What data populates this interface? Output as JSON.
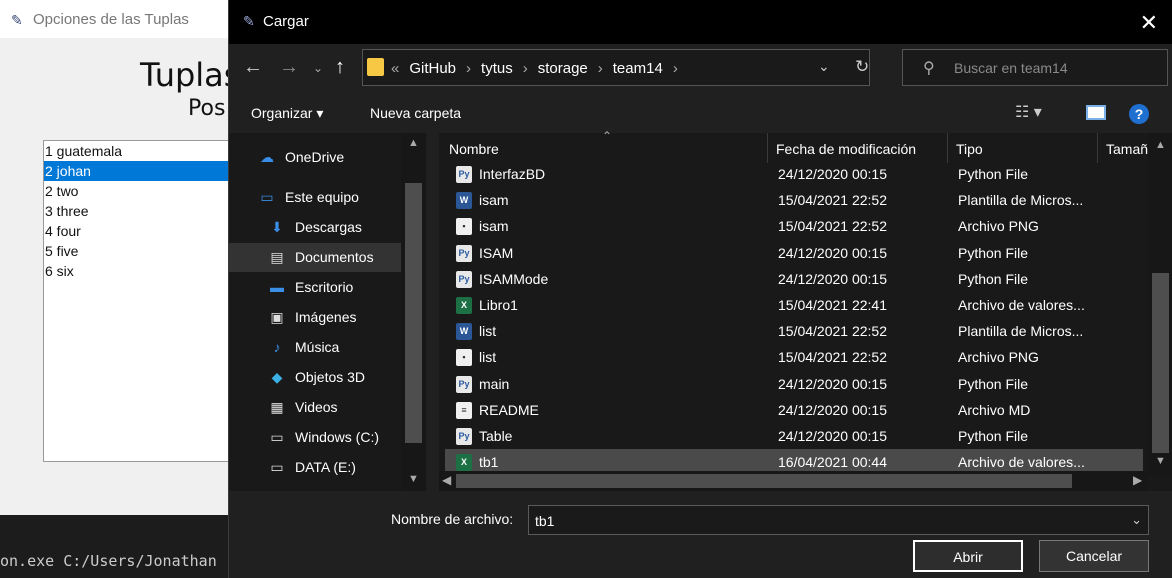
{
  "background_window": {
    "title": "Opciones de las Tuplas",
    "heading": "Tuplas",
    "subheading": "Pos",
    "list": [
      {
        "label": "1 guatemala",
        "selected": false
      },
      {
        "label": "2 johan",
        "selected": true
      },
      {
        "label": "2 two",
        "selected": false
      },
      {
        "label": "3 three",
        "selected": false
      },
      {
        "label": "4 four",
        "selected": false
      },
      {
        "label": "5 five",
        "selected": false
      },
      {
        "label": "6 six",
        "selected": false
      }
    ],
    "terminal_text": "on.exe C:/Users/Jonathan"
  },
  "dialog": {
    "title": "Cargar",
    "address": {
      "prefix": "«",
      "crumbs": [
        "GitHub",
        "tytus",
        "storage",
        "team14"
      ]
    },
    "search_placeholder": "Buscar en team14",
    "toolbar": {
      "organize_label": "Organizar",
      "new_folder_label": "Nueva carpeta",
      "help_label": "?"
    },
    "nav_items": [
      {
        "label": "OneDrive",
        "icon": "cloud-icon",
        "color": "#3a8ee6"
      },
      {
        "label": "Este equipo",
        "icon": "computer-icon",
        "color": "#3a8ee6"
      },
      {
        "label": "Descargas",
        "icon": "download-icon",
        "color": "#3a8ee6"
      },
      {
        "label": "Documentos",
        "icon": "document-icon",
        "color": "#dddddd",
        "selected": true
      },
      {
        "label": "Escritorio",
        "icon": "desktop-icon",
        "color": "#3a8ee6"
      },
      {
        "label": "Imágenes",
        "icon": "image-icon",
        "color": "#dddddd"
      },
      {
        "label": "Música",
        "icon": "music-icon",
        "color": "#3a8ee6"
      },
      {
        "label": "Objetos 3D",
        "icon": "cube-icon",
        "color": "#3ab0e6"
      },
      {
        "label": "Videos",
        "icon": "film-icon",
        "color": "#dddddd"
      },
      {
        "label": "Windows (C:)",
        "icon": "drive-icon",
        "color": "#dddddd"
      },
      {
        "label": "DATA (E:)",
        "icon": "drive-icon",
        "color": "#dddddd"
      }
    ],
    "columns": {
      "name": "Nombre",
      "date": "Fecha de modificación",
      "type": "Tipo",
      "size": "Tamañ"
    },
    "files": [
      {
        "name": "InterfazBD",
        "date": "24/12/2020 00:15",
        "type": "Python File",
        "icon": "python-file-icon"
      },
      {
        "name": "isam",
        "date": "15/04/2021 22:52",
        "type": "Plantilla de Micros...",
        "icon": "word-template-icon"
      },
      {
        "name": "isam",
        "date": "15/04/2021 22:52",
        "type": "Archivo PNG",
        "icon": "png-file-icon"
      },
      {
        "name": "ISAM",
        "date": "24/12/2020 00:15",
        "type": "Python File",
        "icon": "python-file-icon"
      },
      {
        "name": "ISAMMode",
        "date": "24/12/2020 00:15",
        "type": "Python File",
        "icon": "python-file-icon"
      },
      {
        "name": "Libro1",
        "date": "15/04/2021 22:41",
        "type": "Archivo de valores...",
        "icon": "excel-file-icon"
      },
      {
        "name": "list",
        "date": "15/04/2021 22:52",
        "type": "Plantilla de Micros...",
        "icon": "word-template-icon"
      },
      {
        "name": "list",
        "date": "15/04/2021 22:52",
        "type": "Archivo PNG",
        "icon": "png-file-icon"
      },
      {
        "name": "main",
        "date": "24/12/2020 00:15",
        "type": "Python File",
        "icon": "python-file-icon"
      },
      {
        "name": "README",
        "date": "24/12/2020 00:15",
        "type": "Archivo MD",
        "icon": "text-file-icon"
      },
      {
        "name": "Table",
        "date": "24/12/2020 00:15",
        "type": "Python File",
        "icon": "python-file-icon"
      },
      {
        "name": "tb1",
        "date": "16/04/2021 00:44",
        "type": "Archivo de valores...",
        "icon": "excel-file-icon",
        "selected": true
      }
    ],
    "filename_label": "Nombre de archivo:",
    "filename_value": "tb1",
    "open_label": "Abrir",
    "cancel_label": "Cancelar"
  }
}
